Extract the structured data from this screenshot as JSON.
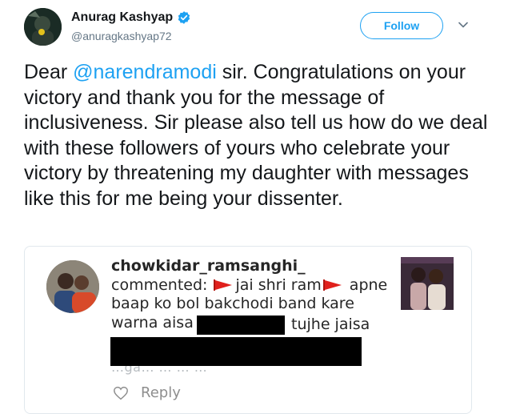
{
  "author": {
    "display_name": "Anurag Kashyap",
    "handle": "@anuragkashyap72",
    "verified": true,
    "avatar_icon": "profile-photo"
  },
  "actions": {
    "follow_label": "Follow",
    "menu_icon": "chevron-down-icon"
  },
  "tweet": {
    "prefix": "Dear ",
    "mention": "@narendramodi",
    "body": " sir. Congratulations on your victory and thank you for the message of inclusiveness. Sir please also tell us how do we deal with these followers of yours who celebrate your victory by threatening my daughter with messages like this for me being your dissenter."
  },
  "embedded_comment": {
    "username": "chowkidar_ramsanghi_",
    "commented_label": "commented:",
    "flag_text_1": "jai shri ram",
    "text_after_flag": "apne baap ko bol bakchodi band kare warna aisa",
    "after_redaction": "tujhe jaisa",
    "partial_hidden_line": "…ga… … … …",
    "reply_label": "Reply",
    "flag_icon": "saffron-flag-icon",
    "like_icon": "heart-icon"
  },
  "colors": {
    "link_blue": "#1da1f2",
    "text_dark": "#14171a",
    "muted_gray": "#657786",
    "flag_red": "#e0201c",
    "verified_blue": "#1da1f2"
  }
}
